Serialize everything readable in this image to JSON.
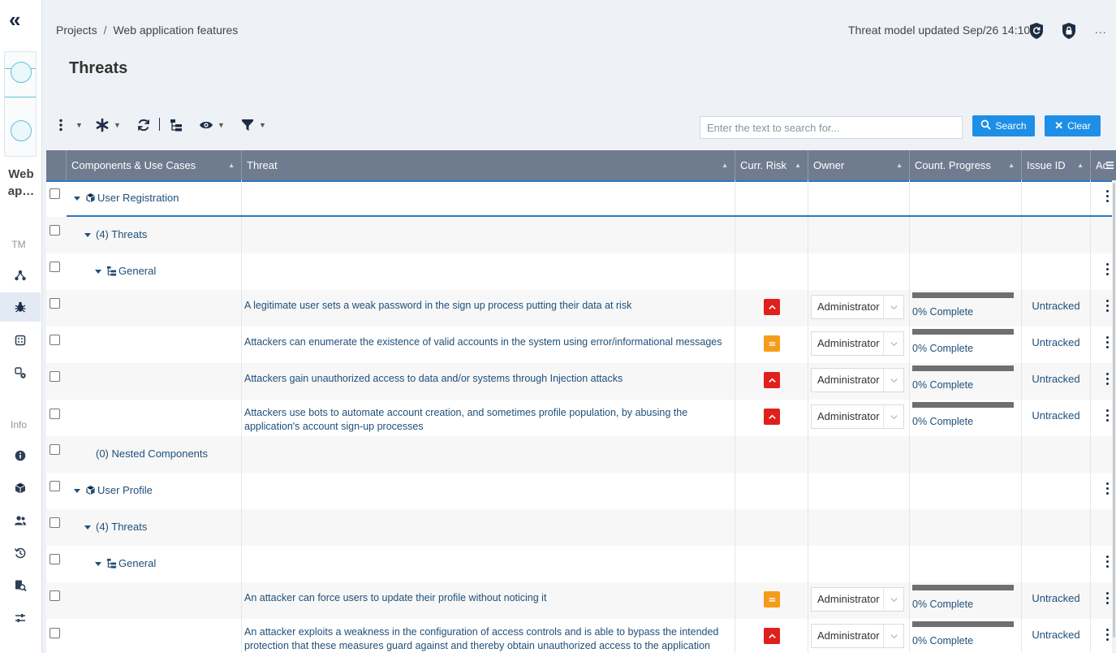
{
  "breadcrumb": {
    "projects": "Projects",
    "separator": "/",
    "current": "Web application features"
  },
  "header": {
    "updated": "Threat model updated Sep/26 14:10",
    "more": "..."
  },
  "page_title": "Threats",
  "sidebar": {
    "project_name": "Web ap…",
    "project_name_line1": "Web",
    "project_name_line2": "ap…",
    "tm_label": "TM",
    "info_label": "Info"
  },
  "search": {
    "placeholder": "Enter the text to search for...",
    "search_label": "Search",
    "clear_label": "Clear"
  },
  "table": {
    "columns": [
      "Components & Use Cases",
      "Threat",
      "Curr. Risk",
      "Owner",
      "Count. Progress",
      "Issue ID",
      "Ac"
    ],
    "rows": [
      {
        "kind": "component",
        "label": "User Registration"
      },
      {
        "kind": "group",
        "label": "(4) Threats"
      },
      {
        "kind": "category",
        "label": "General"
      },
      {
        "kind": "threat",
        "threat": "A legitimate user sets a weak password in the sign up process putting their data at risk",
        "risk": "high",
        "owner": "Administrator",
        "progress": "0% Complete",
        "issue": "Untracked"
      },
      {
        "kind": "threat",
        "threat": "Attackers can enumerate the existence of valid accounts in the system using error/informational messages",
        "risk": "medium",
        "owner": "Administrator",
        "progress": "0% Complete",
        "issue": "Untracked"
      },
      {
        "kind": "threat",
        "threat": "Attackers gain unauthorized access to data and/or systems through Injection attacks",
        "risk": "high",
        "owner": "Administrator",
        "progress": "0% Complete",
        "issue": "Untracked"
      },
      {
        "kind": "threat",
        "threat": "Attackers use bots to automate account creation, and sometimes profile population, by abusing the application's account sign-up processes",
        "risk": "high",
        "owner": "Administrator",
        "progress": "0% Complete",
        "issue": "Untracked"
      },
      {
        "kind": "nested",
        "label": "(0) Nested Components"
      },
      {
        "kind": "component",
        "label": "User Profile"
      },
      {
        "kind": "group",
        "label": "(4) Threats"
      },
      {
        "kind": "category",
        "label": "General"
      },
      {
        "kind": "threat",
        "threat": "An attacker can force users to update their profile without noticing it",
        "risk": "medium",
        "owner": "Administrator",
        "progress": "0% Complete",
        "issue": "Untracked"
      },
      {
        "kind": "threat",
        "threat": "An attacker exploits a weakness in the configuration of access controls and is able to bypass the intended protection that these measures guard against and thereby obtain unauthorized access to the application",
        "risk": "high",
        "owner": "Administrator",
        "progress": "0% Complete",
        "issue": "Untracked"
      }
    ]
  },
  "colors": {
    "accent": "#1e8fe6",
    "header_bg": "#6f7c90",
    "risk_high": "#e0201a",
    "risk_medium": "#f79b1c",
    "link": "#1f4f79"
  }
}
